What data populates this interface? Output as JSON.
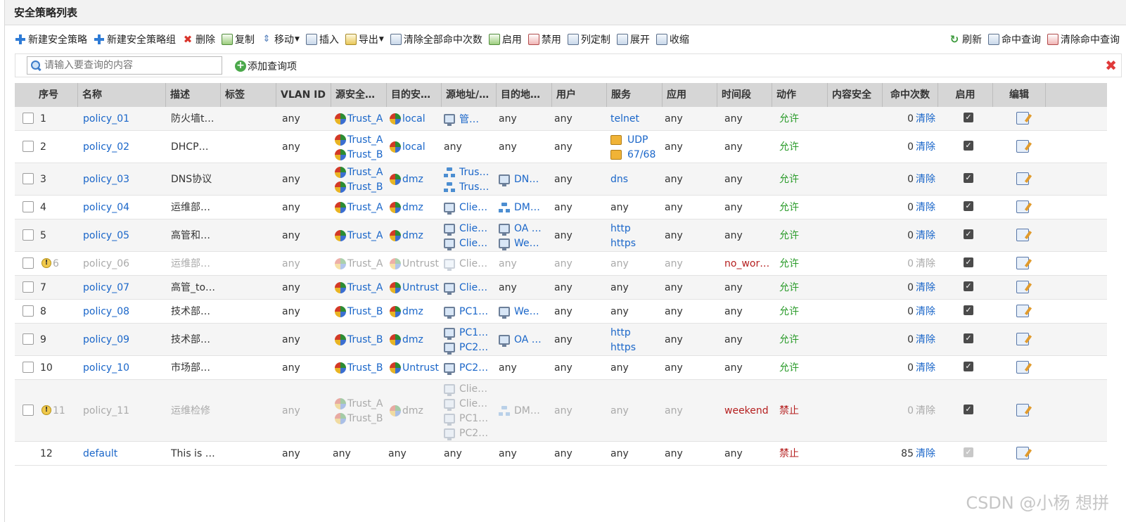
{
  "title": "安全策略列表",
  "toolbar_left": [
    {
      "label": "新建安全策略",
      "icon": "plus-icon"
    },
    {
      "label": "新建安全策略组",
      "icon": "plus-icon"
    },
    {
      "label": "删除",
      "icon": "delete-icon"
    },
    {
      "label": "复制",
      "icon": "copy-icon"
    },
    {
      "label": "移动",
      "icon": "move-icon"
    },
    {
      "label": "插入",
      "icon": "insert-icon"
    },
    {
      "label": "导出",
      "icon": "export-icon"
    },
    {
      "label": "清除全部命中次数",
      "icon": "clear-counter-icon"
    },
    {
      "label": "启用",
      "icon": "enable-icon"
    },
    {
      "label": "禁用",
      "icon": "disable-icon"
    },
    {
      "label": "列定制",
      "icon": "columns-icon"
    },
    {
      "label": "展开",
      "icon": "expand-icon"
    },
    {
      "label": "收缩",
      "icon": "collapse-icon"
    }
  ],
  "toolbar_right": [
    {
      "label": "刷新",
      "icon": "refresh-icon"
    },
    {
      "label": "命中查询",
      "icon": "hit-query-icon"
    },
    {
      "label": "清除命中查询",
      "icon": "clear-hit-query-icon"
    }
  ],
  "search": {
    "placeholder": "请输入要查询的内容",
    "add_query": "添加查询项"
  },
  "columns": [
    "序号",
    "名称",
    "描述",
    "标签",
    "VLAN ID",
    "源安全…",
    "目的安…",
    "源地址/…",
    "目的地…",
    "用户",
    "服务",
    "应用",
    "时间段",
    "动作",
    "内容安全",
    "命中次数",
    "启用",
    "编辑"
  ],
  "clear_label": "清除",
  "rows": [
    {
      "no": "1",
      "name": "policy_01",
      "desc": "防火墙t…",
      "vlan": "any",
      "src_zone": [
        "Trust_A"
      ],
      "dst_zone": [
        "local"
      ],
      "src_addr": [
        {
          "t": "host",
          "v": "管…"
        }
      ],
      "dst_addr": [
        {
          "t": "text",
          "v": "any"
        }
      ],
      "user": "any",
      "service": [
        {
          "t": "link",
          "v": "telnet"
        }
      ],
      "app": "any",
      "schedule": "any",
      "action": "允许",
      "hits": "0",
      "enabled": true,
      "disabled": false
    },
    {
      "no": "2",
      "name": "policy_02",
      "desc": "DHCP…",
      "vlan": "any",
      "src_zone": [
        "Trust_A",
        "Trust_B"
      ],
      "dst_zone": [
        "local"
      ],
      "src_addr": [
        {
          "t": "text",
          "v": "any"
        }
      ],
      "dst_addr": [
        {
          "t": "text",
          "v": "any"
        }
      ],
      "user": "any",
      "service": [
        {
          "t": "svc",
          "v": "UDP"
        },
        {
          "t": "svc",
          "v": "67/68"
        }
      ],
      "app": "any",
      "schedule": "any",
      "action": "允许",
      "hits": "0",
      "enabled": true,
      "disabled": false
    },
    {
      "no": "3",
      "name": "policy_03",
      "desc": "DNS协议",
      "vlan": "any",
      "src_zone": [
        "Trust_A",
        "Trust_B"
      ],
      "dst_zone": [
        "dmz"
      ],
      "src_addr": [
        {
          "t": "net",
          "v": "Trus…"
        },
        {
          "t": "net",
          "v": "Trus…"
        }
      ],
      "dst_addr": [
        {
          "t": "host",
          "v": "DN…"
        }
      ],
      "user": "any",
      "service": [
        {
          "t": "link",
          "v": "dns"
        }
      ],
      "app": "any",
      "schedule": "any",
      "action": "允许",
      "hits": "0",
      "enabled": true,
      "disabled": false
    },
    {
      "no": "4",
      "name": "policy_04",
      "desc": "运维部…",
      "vlan": "any",
      "src_zone": [
        "Trust_A"
      ],
      "dst_zone": [
        "dmz"
      ],
      "src_addr": [
        {
          "t": "host",
          "v": "Clie…"
        }
      ],
      "dst_addr": [
        {
          "t": "net",
          "v": "DM…"
        }
      ],
      "user": "any",
      "service": [
        {
          "t": "text",
          "v": "any"
        }
      ],
      "app": "any",
      "schedule": "any",
      "action": "允许",
      "hits": "0",
      "enabled": true,
      "disabled": false
    },
    {
      "no": "5",
      "name": "policy_05",
      "desc": "高管和…",
      "vlan": "any",
      "src_zone": [
        "Trust_A"
      ],
      "dst_zone": [
        "dmz"
      ],
      "src_addr": [
        {
          "t": "host",
          "v": "Clie…"
        },
        {
          "t": "host",
          "v": "Clie…"
        }
      ],
      "dst_addr": [
        {
          "t": "host",
          "v": "OA …"
        },
        {
          "t": "host",
          "v": "We…"
        }
      ],
      "user": "any",
      "service": [
        {
          "t": "link",
          "v": "http"
        },
        {
          "t": "link",
          "v": "https"
        }
      ],
      "app": "any",
      "schedule": "any",
      "action": "允许",
      "hits": "0",
      "enabled": true,
      "disabled": false
    },
    {
      "no": "6",
      "name": "policy_06",
      "desc": "运维部…",
      "vlan": "any",
      "src_zone": [
        "Trust_A"
      ],
      "dst_zone": [
        "Untrust"
      ],
      "src_addr": [
        {
          "t": "host",
          "v": "Clie…"
        }
      ],
      "dst_addr": [
        {
          "t": "text",
          "v": "any"
        }
      ],
      "user": "any",
      "service": [
        {
          "t": "text",
          "v": "any"
        }
      ],
      "app": "any",
      "schedule": "no_wor…",
      "action": "允许",
      "hits": "0",
      "enabled": true,
      "disabled": true
    },
    {
      "no": "7",
      "name": "policy_07",
      "desc": "高管_to…",
      "vlan": "any",
      "src_zone": [
        "Trust_A"
      ],
      "dst_zone": [
        "Untrust"
      ],
      "src_addr": [
        {
          "t": "host",
          "v": "Clie…"
        }
      ],
      "dst_addr": [
        {
          "t": "text",
          "v": "any"
        }
      ],
      "user": "any",
      "service": [
        {
          "t": "text",
          "v": "any"
        }
      ],
      "app": "any",
      "schedule": "any",
      "action": "允许",
      "hits": "0",
      "enabled": true,
      "disabled": false
    },
    {
      "no": "8",
      "name": "policy_08",
      "desc": "技术部…",
      "vlan": "any",
      "src_zone": [
        "Trust_B"
      ],
      "dst_zone": [
        "dmz"
      ],
      "src_addr": [
        {
          "t": "host",
          "v": "PC1…"
        }
      ],
      "dst_addr": [
        {
          "t": "host",
          "v": "We…"
        }
      ],
      "user": "any",
      "service": [
        {
          "t": "text",
          "v": "any"
        }
      ],
      "app": "any",
      "schedule": "any",
      "action": "允许",
      "hits": "0",
      "enabled": true,
      "disabled": false
    },
    {
      "no": "9",
      "name": "policy_09",
      "desc": "技术部…",
      "vlan": "any",
      "src_zone": [
        "Trust_B"
      ],
      "dst_zone": [
        "dmz"
      ],
      "src_addr": [
        {
          "t": "host",
          "v": "PC1…"
        },
        {
          "t": "host",
          "v": "PC2…"
        }
      ],
      "dst_addr": [
        {
          "t": "host",
          "v": "OA …"
        }
      ],
      "user": "any",
      "service": [
        {
          "t": "link",
          "v": "http"
        },
        {
          "t": "link",
          "v": "https"
        }
      ],
      "app": "any",
      "schedule": "any",
      "action": "允许",
      "hits": "0",
      "enabled": true,
      "disabled": false
    },
    {
      "no": "10",
      "name": "policy_10",
      "desc": "市场部…",
      "vlan": "any",
      "src_zone": [
        "Trust_B"
      ],
      "dst_zone": [
        "Untrust"
      ],
      "src_addr": [
        {
          "t": "host",
          "v": "PC2…"
        }
      ],
      "dst_addr": [
        {
          "t": "text",
          "v": "any"
        }
      ],
      "user": "any",
      "service": [
        {
          "t": "text",
          "v": "any"
        }
      ],
      "app": "any",
      "schedule": "any",
      "action": "允许",
      "hits": "0",
      "enabled": true,
      "disabled": false
    },
    {
      "no": "11",
      "name": "policy_11",
      "desc": "运维检修",
      "vlan": "any",
      "src_zone": [
        "Trust_A",
        "Trust_B"
      ],
      "dst_zone": [
        "dmz"
      ],
      "src_addr": [
        {
          "t": "host",
          "v": "Clie…"
        },
        {
          "t": "host",
          "v": "Clie…"
        },
        {
          "t": "host",
          "v": "PC1…"
        },
        {
          "t": "host",
          "v": "PC2…"
        }
      ],
      "dst_addr": [
        {
          "t": "net",
          "v": "DM…"
        }
      ],
      "user": "any",
      "service": [
        {
          "t": "text",
          "v": "any"
        }
      ],
      "app": "any",
      "schedule": "weekend",
      "action": "禁止",
      "hits": "0",
      "enabled": true,
      "disabled": true
    },
    {
      "no": "12",
      "name": "default",
      "desc": "This is …",
      "vlan": "any",
      "src_zone_text": "any",
      "dst_zone_text": "any",
      "src_addr": [
        {
          "t": "text",
          "v": "any"
        }
      ],
      "dst_addr": [
        {
          "t": "text",
          "v": "any"
        }
      ],
      "user": "any",
      "service": [
        {
          "t": "text",
          "v": "any"
        }
      ],
      "app": "any",
      "schedule": "any",
      "action": "禁止",
      "hits": "85",
      "enabled": true,
      "disabled": false,
      "default": true
    }
  ],
  "watermark": "CSDN @小杨 想拼"
}
